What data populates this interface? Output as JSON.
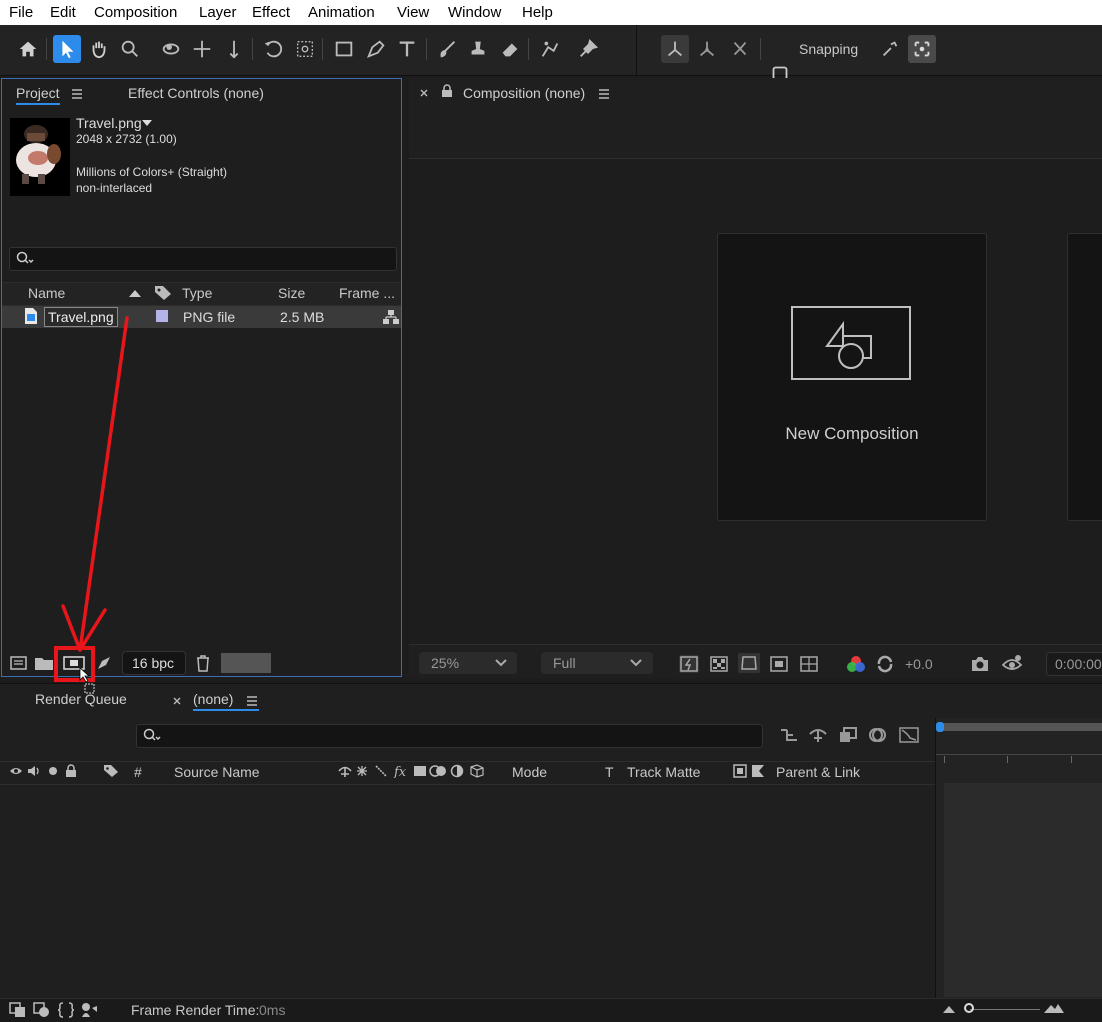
{
  "menu": [
    "File",
    "Edit",
    "Composition",
    "Layer",
    "Effect",
    "Animation",
    "View",
    "Window",
    "Help"
  ],
  "toolbar": {
    "snapping_label": "Snapping"
  },
  "project": {
    "tab_project": "Project",
    "tab_effect_controls": "Effect Controls (none)",
    "file_name": "Travel.png",
    "dimensions": "2048 x 2732 (1.00)",
    "colors": "Millions of Colors+ (Straight)",
    "interlace": "non-interlaced",
    "columns": {
      "name": "Name",
      "type": "Type",
      "size": "Size",
      "frame": "Frame ..."
    },
    "row": {
      "name": "Travel.png",
      "type": "PNG file",
      "size": "2.5 MB"
    },
    "bpc": "16 bpc"
  },
  "composition": {
    "tab": "Composition (none)",
    "new_comp_label": "New Composition",
    "zoom": "25%",
    "resolution": "Full",
    "exposure": "+0.0",
    "timecode": "0:00:00"
  },
  "timeline": {
    "tab_render_queue": "Render Queue",
    "tab_none": "(none)",
    "columns": {
      "hash": "#",
      "source_name": "Source Name",
      "mode": "Mode",
      "t": "T",
      "track_matte": "Track Matte",
      "parent": "Parent & Link"
    },
    "frame_render_label": "Frame Render Time:",
    "frame_render_value": "0ms"
  },
  "colors": {
    "accent": "#2d8ceb",
    "annotation": "#e8161b",
    "selection_border": "#3d6fb4"
  }
}
